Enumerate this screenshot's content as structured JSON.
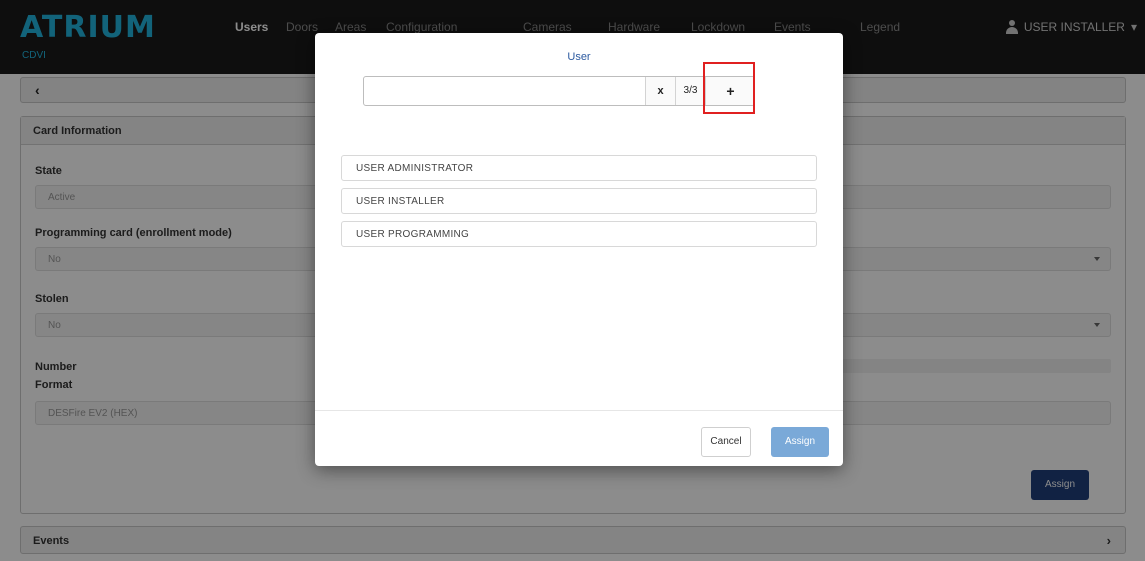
{
  "app": {
    "logo": "ATRIUM",
    "logo_sub": "CDVI"
  },
  "nav": {
    "items": [
      {
        "label": "Users",
        "active": true
      },
      {
        "label": "Doors",
        "active": false
      },
      {
        "label": "Areas",
        "active": false
      },
      {
        "label": "Configuration",
        "active": false
      },
      {
        "label": "Cameras",
        "active": false
      },
      {
        "label": "Hardware",
        "active": false
      },
      {
        "label": "Lockdown",
        "active": false
      },
      {
        "label": "Events",
        "active": false
      },
      {
        "label": "Legend",
        "active": false
      }
    ],
    "user": "USER INSTALLER",
    "user_icon": "user-icon",
    "caret": "▾"
  },
  "page": {
    "back_glyph": "‹",
    "panel_title": "Card Information",
    "fields": {
      "state_label": "State",
      "state_value": "Active",
      "programming_label": "Programming card (enrollment mode)",
      "programming_value": "No",
      "stolen_label": "Stolen",
      "stolen_value": "No",
      "number_label": "Number",
      "format_label": "Format",
      "format_value": "DESFire EV2 (HEX)"
    },
    "assign_label": "Assign",
    "events_label": "Events",
    "events_chevron": "›"
  },
  "modal": {
    "title": "User",
    "search": {
      "value": "",
      "placeholder": "",
      "clear_glyph": "x",
      "count": "3/3",
      "add_glyph": "+"
    },
    "users": [
      "USER ADMINISTRATOR",
      "USER INSTALLER",
      "USER PROGRAMMING"
    ],
    "cancel_label": "Cancel",
    "assign_label": "Assign"
  },
  "colors": {
    "brand": "#21b5de",
    "navbar": "#1b1b1b",
    "primary": "#1f3e7a",
    "primary_disabled": "#7aa9d8",
    "highlight": "#e02020"
  }
}
